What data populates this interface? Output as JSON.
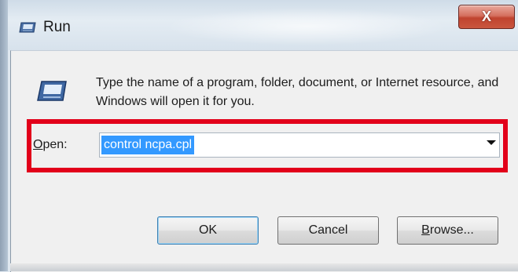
{
  "window": {
    "title": "Run",
    "close_glyph": "X"
  },
  "dialog": {
    "description": "Type the name of a program, folder, document, or Internet resource, and Windows will open it for you.",
    "open_label_accel": "O",
    "open_label_rest": "pen:",
    "command_value": "control ncpa.cpl"
  },
  "buttons": {
    "ok": "OK",
    "cancel": "Cancel",
    "browse_accel": "B",
    "browse_rest": "rowse..."
  },
  "colors": {
    "highlight_box": "#e2001a",
    "selection": "#3399ff",
    "close_button": "#c9563f"
  },
  "icons": {
    "title_icon": "run-icon",
    "dialog_icon": "run-icon"
  }
}
